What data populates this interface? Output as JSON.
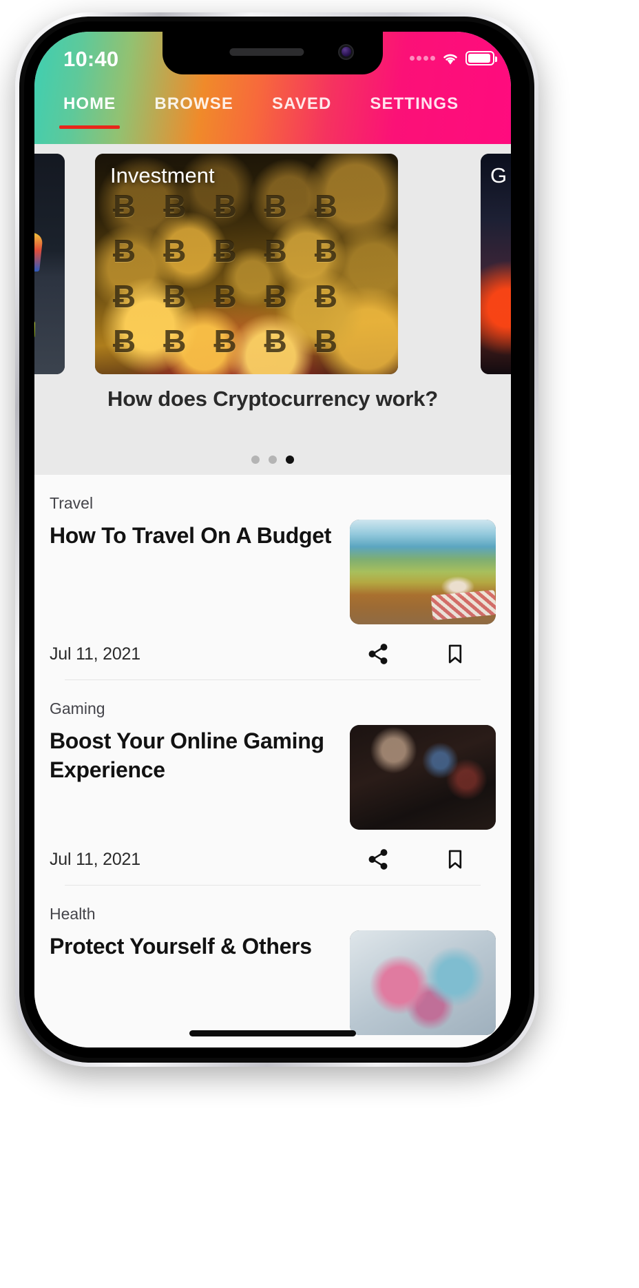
{
  "status_bar": {
    "time": "10:40",
    "signal_icon": "signal-dots-icon",
    "wifi_icon": "wifi-icon",
    "battery_icon": "battery-full-icon"
  },
  "tabs": [
    {
      "label": "HOME",
      "active": true
    },
    {
      "label": "BROWSE",
      "active": false
    },
    {
      "label": "SAVED",
      "active": false
    },
    {
      "label": "SETTINGS",
      "active": false
    }
  ],
  "colors": {
    "gradient_start": "#3ecfb2",
    "gradient_mid": "#f76a3b",
    "gradient_end": "#ff0b7e",
    "active_tab_underline": "#e8261a",
    "carousel_background": "#e9e9e9",
    "list_background": "#fafafa",
    "title_text": "#121212",
    "dot_active": "#111111",
    "dot_inactive": "#b4b4b4"
  },
  "carousel": {
    "label_current": "Investment",
    "label_next": "G",
    "caption": "How does Cryptocurrency work?",
    "bitcoin_glyphs": "ɃɃɃɃɃɃɃɃɃɃɃɃɃɃɃɃɃɃɃɃɃ",
    "dots": [
      {
        "active": false
      },
      {
        "active": false
      },
      {
        "active": true
      }
    ]
  },
  "articles": [
    {
      "category": "Travel",
      "title": "How To Travel On A Budget",
      "date": "Jul 11, 2021",
      "thumb_class": "th-travel",
      "share_icon": "share-icon",
      "bookmark_icon": "bookmark-icon"
    },
    {
      "category": "Gaming",
      "title": "Boost Your Online Gaming Experience",
      "date": "Jul 11, 2021",
      "thumb_class": "th-gaming",
      "share_icon": "share-icon",
      "bookmark_icon": "bookmark-icon"
    },
    {
      "category": "Health",
      "title": "Protect Yourself & Others",
      "date": "",
      "thumb_class": "th-health",
      "share_icon": "share-icon",
      "bookmark_icon": "bookmark-icon"
    }
  ]
}
